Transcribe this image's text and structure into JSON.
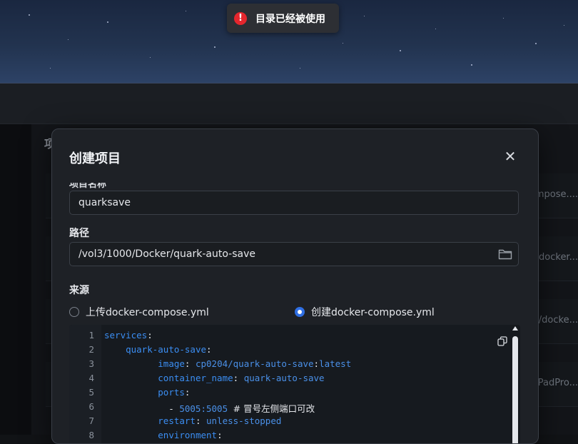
{
  "toast": {
    "icon": "error-circle-icon",
    "text": "目录已经被使用"
  },
  "background": {
    "heading": "项",
    "rows": [
      "compose....",
      "/docker...",
      "o/docke...",
      "tPadPro..."
    ]
  },
  "modal": {
    "title": "创建项目",
    "close_icon": "close-icon",
    "clipped_label": "项目名称",
    "name_value": "quarksave",
    "path_label": "路径",
    "path_value": "/vol3/1000/Docker/quark-auto-save",
    "folder_icon": "folder-icon",
    "source_label": "来源",
    "source_options": [
      {
        "label": "上传docker-compose.yml",
        "checked": false
      },
      {
        "label": "创建docker-compose.yml",
        "checked": true
      }
    ]
  },
  "editor": {
    "line_numbers": [
      "1",
      "2",
      "3",
      "4",
      "5",
      "6",
      "7",
      "8"
    ],
    "lines": {
      "l1_key": "services",
      "l2_key": "quark-auto-save",
      "l3_key": "image",
      "l3_val": "cp0204/quark-auto-save",
      "l3_tag": "latest",
      "l4_key": "container_name",
      "l4_val": "quark-auto-save",
      "l5_key": "ports",
      "l6_val": "5005:5005",
      "l6_comment": "# 冒号左侧端口可改",
      "l7_key": "restart",
      "l7_val": "unless-stopped",
      "l8_key": "environment"
    },
    "copy_icon": "copy-icon"
  }
}
